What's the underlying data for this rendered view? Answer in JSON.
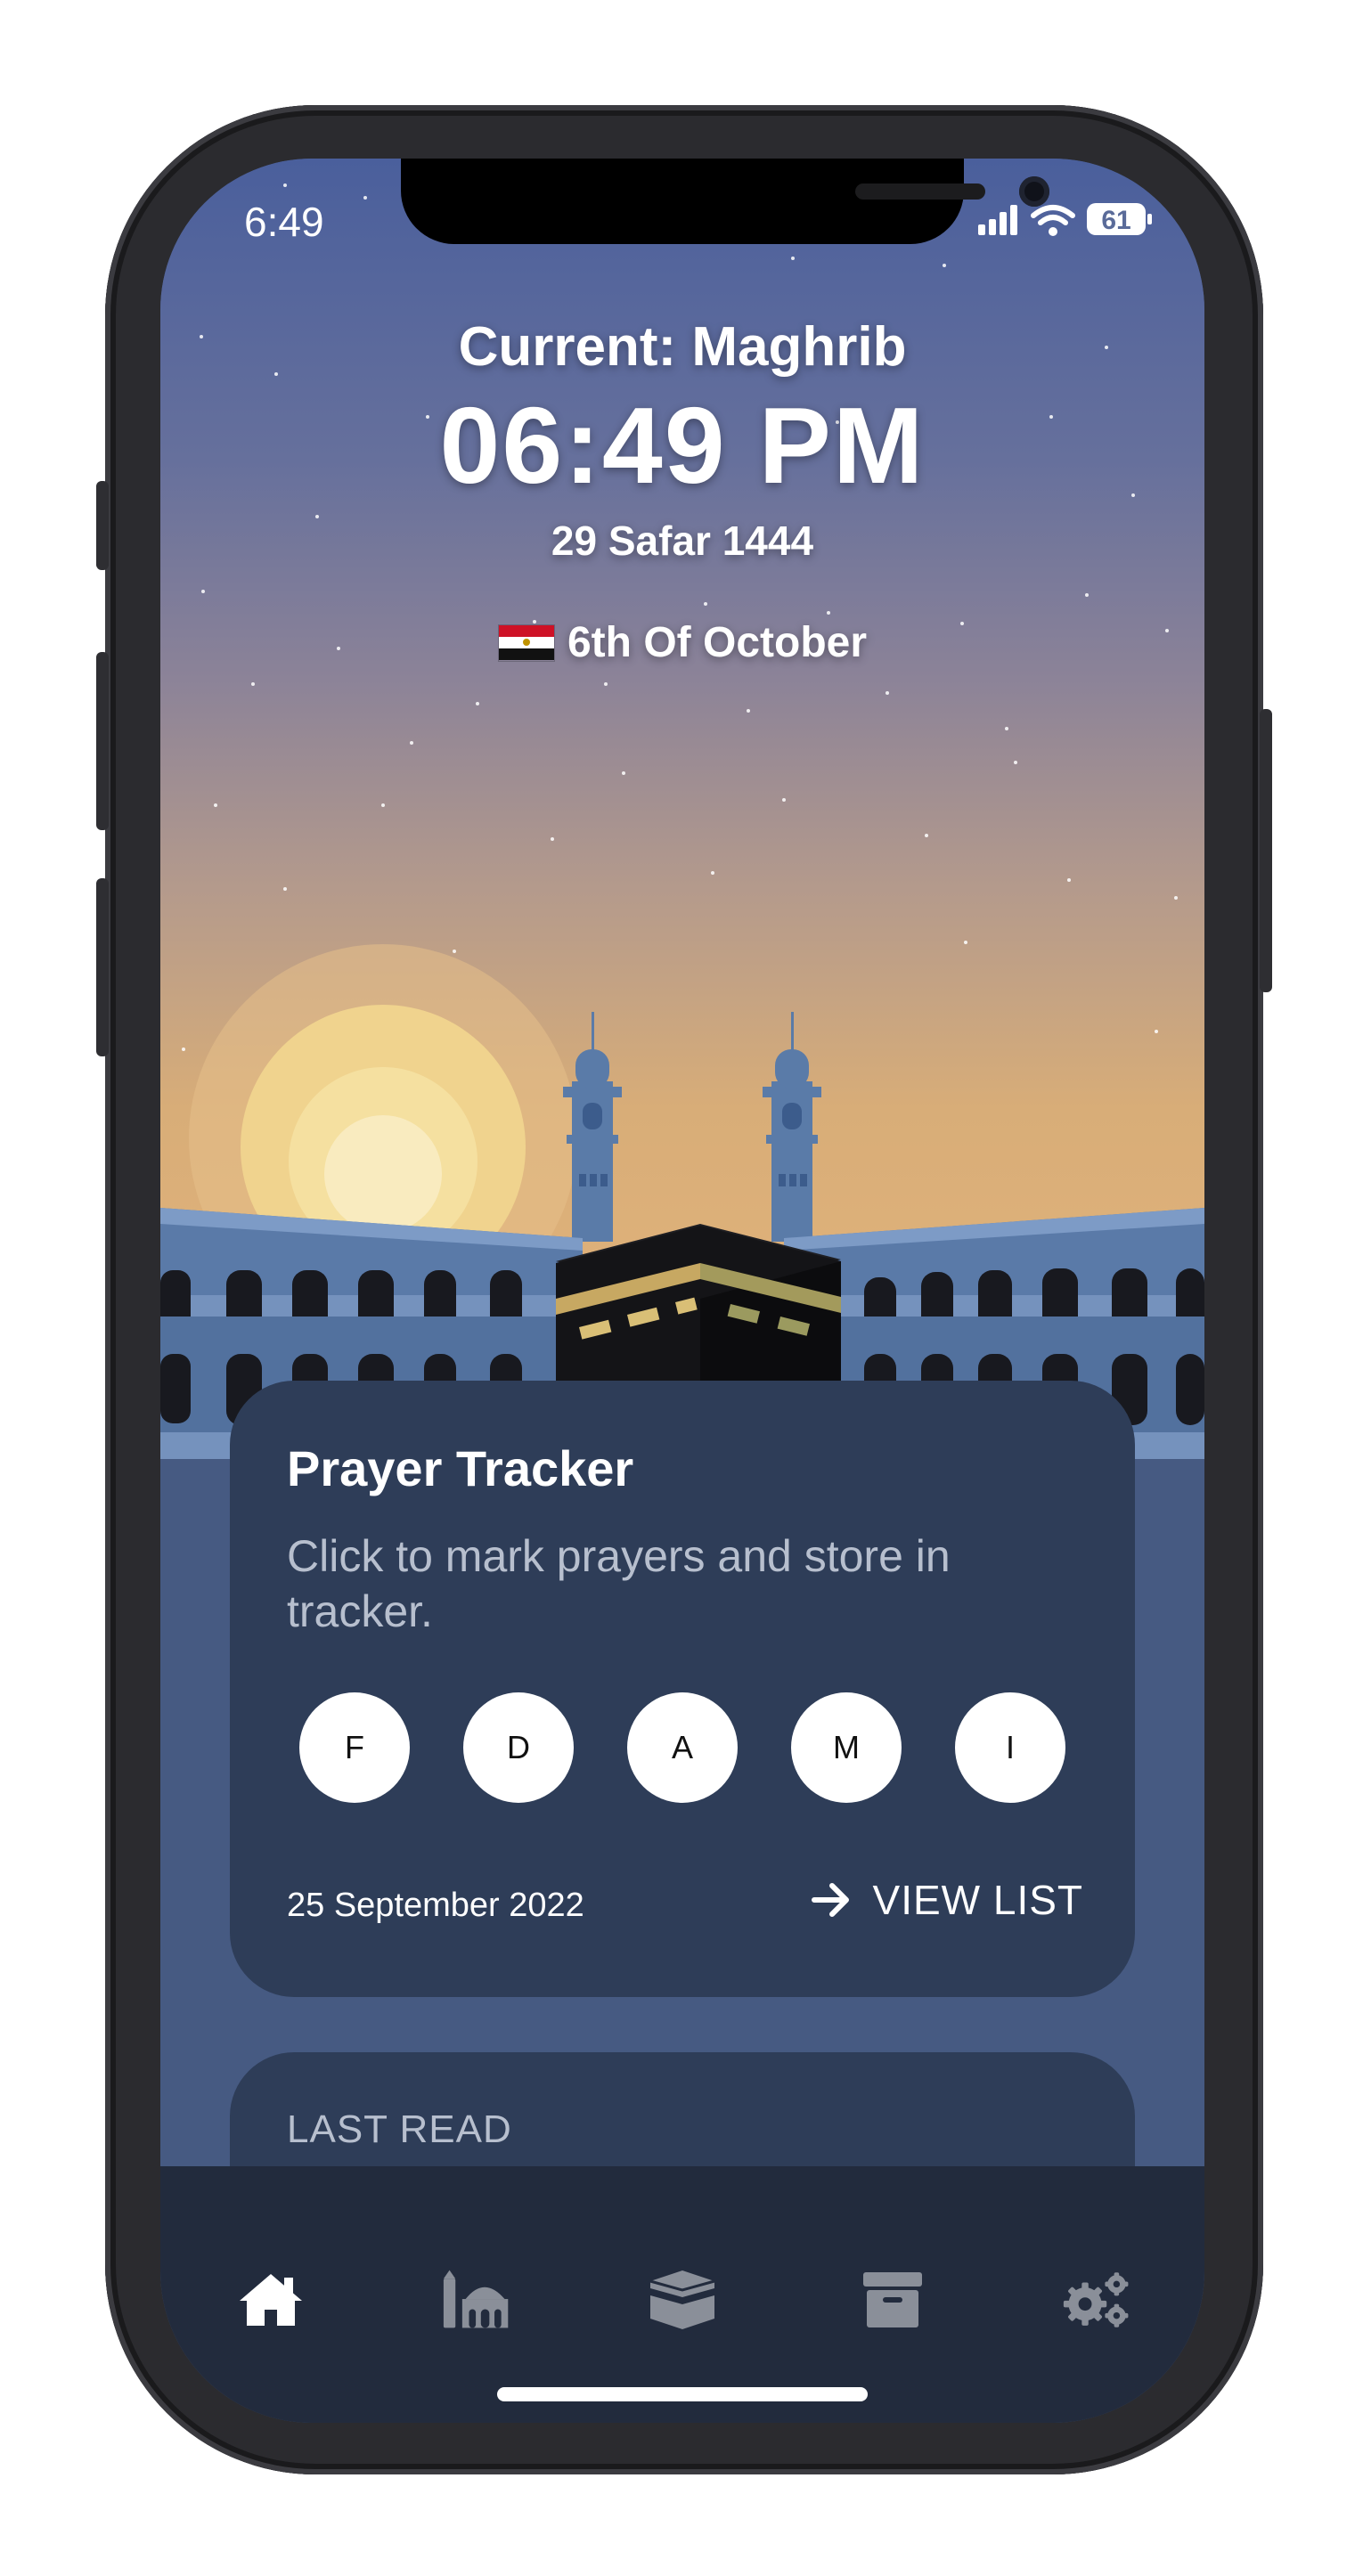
{
  "status_bar": {
    "time": "6:49",
    "battery": "61"
  },
  "header": {
    "current_prayer": "Current: Maghrib",
    "time": "06:49 PM",
    "hijri_date": "29 Safar 1444",
    "location": "6th Of October"
  },
  "prayer_tracker": {
    "title": "Prayer Tracker",
    "subtitle": "Click to mark prayers and store in tracker.",
    "prayers": [
      "F",
      "D",
      "A",
      "M",
      "I"
    ],
    "date": "25 September 2022",
    "view_list_label": "VIEW LIST"
  },
  "last_read": {
    "title": "LAST READ"
  },
  "bottom_nav": {
    "items": [
      {
        "icon": "home-icon",
        "active": true
      },
      {
        "icon": "mosque-icon",
        "active": false
      },
      {
        "icon": "kaaba-icon",
        "active": false
      },
      {
        "icon": "archive-icon",
        "active": false
      },
      {
        "icon": "settings-gears-icon",
        "active": false
      }
    ]
  },
  "colors": {
    "card_bg": "#2e3d58",
    "page_bg": "#465a82",
    "nav_bg": "#222b3d",
    "nav_active": "#ffffff",
    "nav_inactive": "#8a8f99"
  }
}
